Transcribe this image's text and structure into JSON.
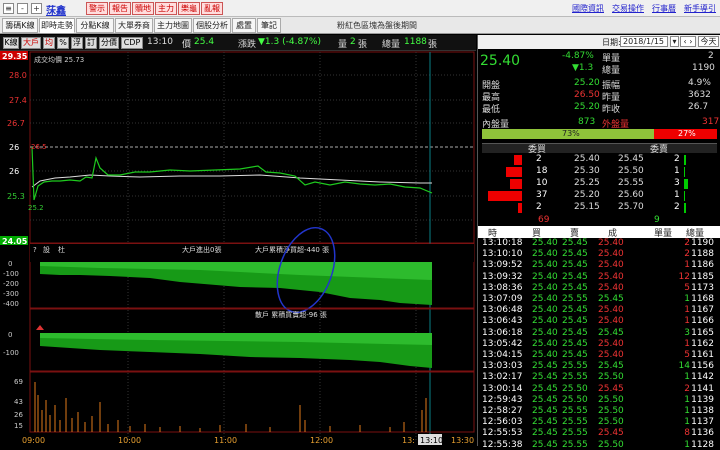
{
  "topbar": {
    "stock": "莯鑫",
    "red_buttons": [
      "警示",
      "報告",
      "贖地",
      "主力",
      "樂龜",
      "亂報"
    ],
    "links": [
      "國際資訊",
      "交易操作",
      "行事曆",
      "新手導引"
    ]
  },
  "tabs": [
    "籌碼K線",
    "即時走勢",
    "分點K線",
    "大單券商",
    "主力地圖",
    "個股分析",
    "處置",
    "筆記"
  ],
  "notice": "粉紅色區塊為盤後期間",
  "chartbar": {
    "buttons": [
      "K線",
      "大戶",
      "均",
      "%",
      "浮",
      "訂",
      "分價",
      "CDP"
    ],
    "time": "13:10",
    "price_label": "價",
    "price": "25.4",
    "change_label": "漲跌",
    "change": "▼1.3 (-4.87%)",
    "vol_label": "量",
    "vol": "2",
    "vol_unit": "張",
    "total_label": "總量",
    "total": "1188",
    "total_unit": "張"
  },
  "main_chart": {
    "avg_label": "成交均價 25.73",
    "prices": [
      "29.35",
      "28.0",
      "27.4",
      "26.7",
      "26",
      "25.3",
      "24.05"
    ],
    "mark_high": "26.5",
    "mark_low": "25.2",
    "ref": "26.7"
  },
  "sub1": {
    "btns": [
      "?",
      "設",
      "杜"
    ],
    "label1": "大戶進出0張",
    "label2": "大戶累積淨買超-440 張",
    "ticks": [
      "0",
      "-100",
      "-200",
      "-300",
      "-400"
    ]
  },
  "sub2": {
    "label": "散戶 累積買賣超-96 張",
    "ticks": [
      "0",
      "-100"
    ]
  },
  "sub3": {
    "ticks": [
      "69",
      "43",
      "26",
      "15"
    ]
  },
  "xaxis": {
    "labels": [
      "09:00",
      "10:00",
      "11:00",
      "12:00",
      "13:",
      "13:10",
      "13:30"
    ]
  },
  "date": {
    "label": "日期:",
    "value": "2018/1/15",
    "today": "今天"
  },
  "quote": {
    "price": "25.40",
    "pct": "-4.87%",
    "chg": "▼1.3",
    "single_label": "單量",
    "single": "2",
    "total_label": "總量",
    "total": "1190",
    "stats": [
      [
        "開盤",
        "25.20",
        "振幅",
        "4.9%"
      ],
      [
        "最高",
        "26.50",
        "昨量",
        "3632"
      ],
      [
        "最低",
        "25.20",
        "昨收",
        "26.7"
      ]
    ]
  },
  "inout": {
    "in_label": "內盤量",
    "in": "873",
    "out_label": "外盤量",
    "out": "317",
    "in_pct": "73%",
    "out_pct": "27%",
    "in_frac": 0.73
  },
  "book": {
    "bid_header": "委買",
    "ask_header": "委賣",
    "rows": [
      [
        "2",
        "25.40",
        "25.45",
        "2"
      ],
      [
        "18",
        "25.30",
        "25.50",
        "1"
      ],
      [
        "10",
        "25.25",
        "25.55",
        "3"
      ],
      [
        "37",
        "25.20",
        "25.60",
        "1"
      ],
      [
        "2",
        "25.15",
        "25.70",
        "2"
      ]
    ],
    "bid_total": "69",
    "ask_total": "9"
  },
  "ticks_header": [
    "時",
    "買",
    "賣",
    "成",
    "單量",
    "總量"
  ],
  "ticks": [
    [
      "13:10:18",
      "25.40",
      "25.45",
      "25.40",
      "2",
      "1190"
    ],
    [
      "13:10:10",
      "25.40",
      "25.45",
      "25.40",
      "2",
      "1188"
    ],
    [
      "13:09:52",
      "25.40",
      "25.45",
      "25.40",
      "1",
      "1186"
    ],
    [
      "13:09:32",
      "25.40",
      "25.45",
      "25.40",
      "12",
      "1185"
    ],
    [
      "13:08:36",
      "25.40",
      "25.45",
      "25.40",
      "5",
      "1173"
    ],
    [
      "13:07:09",
      "25.40",
      "25.55",
      "25.45",
      "1",
      "1168"
    ],
    [
      "13:06:48",
      "25.40",
      "25.45",
      "25.40",
      "1",
      "1167"
    ],
    [
      "13:06:43",
      "25.40",
      "25.45",
      "25.40",
      "1",
      "1166"
    ],
    [
      "13:06:18",
      "25.40",
      "25.45",
      "25.45",
      "3",
      "1165"
    ],
    [
      "13:05:42",
      "25.40",
      "25.45",
      "25.40",
      "1",
      "1162"
    ],
    [
      "13:04:15",
      "25.40",
      "25.45",
      "25.40",
      "5",
      "1161"
    ],
    [
      "13:03:03",
      "25.45",
      "25.55",
      "25.45",
      "14",
      "1156"
    ],
    [
      "13:02:17",
      "25.45",
      "25.55",
      "25.50",
      "1",
      "1142"
    ],
    [
      "13:00:14",
      "25.45",
      "25.50",
      "25.45",
      "2",
      "1141"
    ],
    [
      "12:59:43",
      "25.45",
      "25.50",
      "25.50",
      "1",
      "1139"
    ],
    [
      "12:58:27",
      "25.45",
      "25.55",
      "25.50",
      "1",
      "1138"
    ],
    [
      "12:56:03",
      "25.45",
      "25.55",
      "25.50",
      "1",
      "1137"
    ],
    [
      "12:55:53",
      "25.45",
      "25.55",
      "25.45",
      "8",
      "1136"
    ],
    [
      "12:55:38",
      "25.45",
      "25.55",
      "25.50",
      "1",
      "1128"
    ]
  ],
  "tick_colors": [
    "r",
    "r",
    "r",
    "r",
    "r",
    "g",
    "r",
    "r",
    "g",
    "r",
    "r",
    "g",
    "g",
    "r",
    "g",
    "g",
    "g",
    "r",
    "g"
  ]
}
